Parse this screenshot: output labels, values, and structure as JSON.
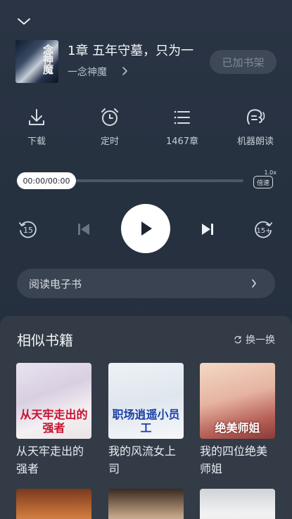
{
  "player": {
    "collapse_icon": "chevron-down-icon",
    "chapter_title": "1章 五年守墓，只为一",
    "author": "一念神魔",
    "author_suffix": "",
    "cover_text": "念神魔",
    "shelf_button": "已加书架"
  },
  "actions": [
    {
      "label": "下载",
      "icon": "download-icon"
    },
    {
      "label": "定时",
      "icon": "alarm-clock-icon"
    },
    {
      "label": "1467章",
      "icon": "chapter-list-icon"
    },
    {
      "label": "机器朗读",
      "icon": "tts-voice-icon"
    }
  ],
  "progress": {
    "time": "00:00/00:00",
    "fraction": 0.0,
    "speed_label": "倍速",
    "speed_value": "1.0x"
  },
  "controls": {
    "rewind": "15",
    "forward": "15+"
  },
  "ebook": {
    "label": "阅读电子书"
  },
  "similar": {
    "title": "相似书籍",
    "refresh_label": "换一换",
    "books": [
      {
        "title": "从天牢走出的强者",
        "cover_text": "从天牢走出的强者",
        "cover_color": "#c8102e"
      },
      {
        "title": "我的风流女上司",
        "cover_text": "职场逍遥小员工",
        "cover_color": "#1a3fa6"
      },
      {
        "title": "我的四位绝美师姐",
        "cover_text": "绝美师姐",
        "cover_color": "#ffffff"
      }
    ]
  },
  "colors": {
    "background": "#263140",
    "panel": "#333b47",
    "play_button": "#ffffff"
  }
}
